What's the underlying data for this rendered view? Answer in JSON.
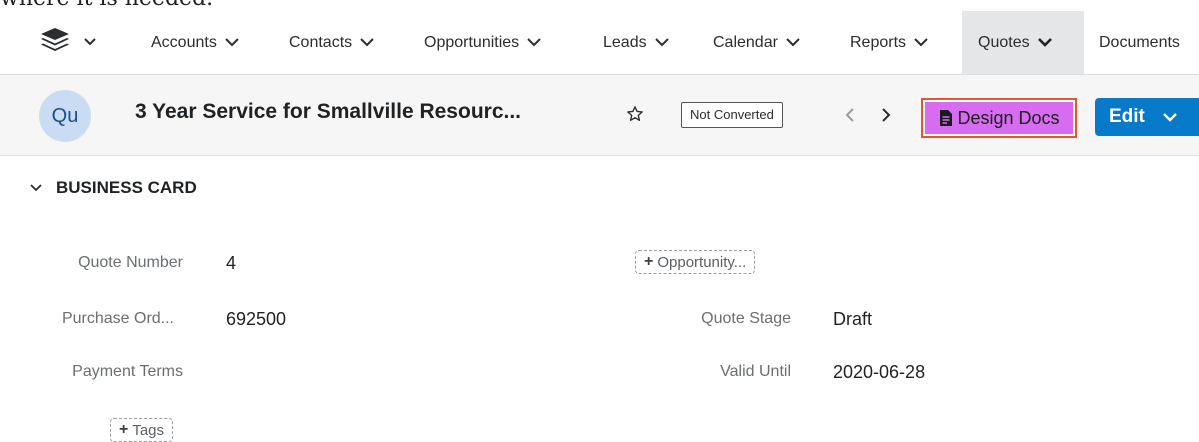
{
  "caption": "where it is needed.",
  "nav": {
    "items": [
      {
        "label": "Accounts"
      },
      {
        "label": "Contacts"
      },
      {
        "label": "Opportunities"
      },
      {
        "label": "Leads"
      },
      {
        "label": "Calendar"
      },
      {
        "label": "Reports"
      },
      {
        "label": "Quotes"
      },
      {
        "label": "Documents"
      }
    ]
  },
  "record": {
    "avatar": "Qu",
    "title": "3 Year Service for Smallville Resourc...",
    "status": "Not Converted",
    "design_docs_label": "Design Docs",
    "edit_label": "Edit"
  },
  "panel": {
    "heading": "BUSINESS CARD",
    "fields": {
      "quote_number": {
        "label": "Quote Number",
        "value": "4"
      },
      "purchase_order": {
        "label": "Purchase Ord...",
        "value": "692500"
      },
      "payment_terms": {
        "label": "Payment Terms",
        "value": ""
      },
      "quote_stage": {
        "label": "Quote Stage",
        "value": "Draft"
      },
      "valid_until": {
        "label": "Valid Until",
        "value": "2020-06-28"
      }
    },
    "opportunity_button": "Opportunity...",
    "tags_button": "Tags"
  },
  "colors": {
    "accent": "#0679c8",
    "design_docs_bg": "#d66df0",
    "highlight_border": "#e4572e"
  }
}
